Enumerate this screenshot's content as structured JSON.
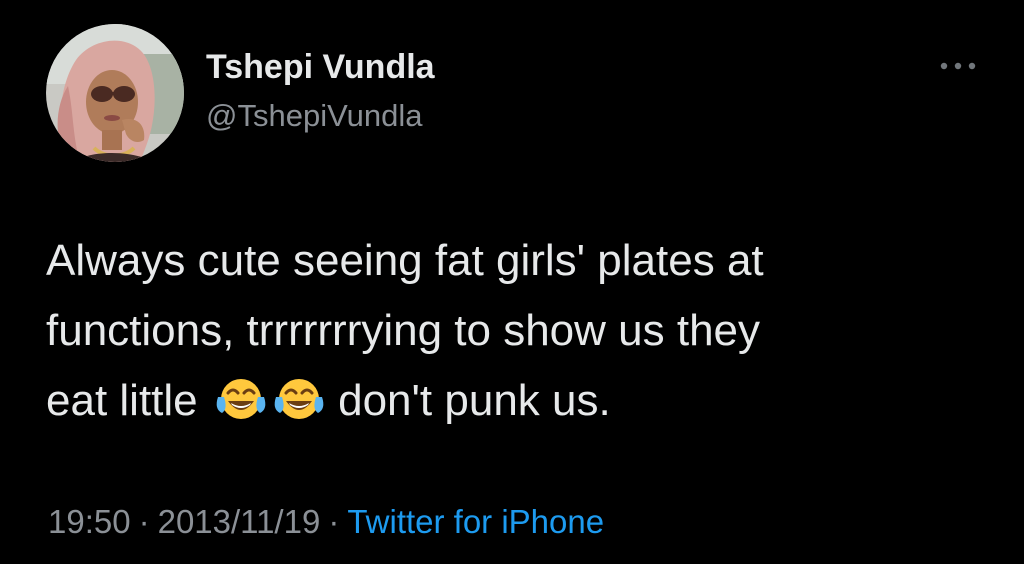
{
  "user": {
    "display_name": "Tshepi Vundla",
    "handle": "@TshepiVundla",
    "avatar_icon": "profile-photo"
  },
  "menu": {
    "icon": "more-horizontal-icon"
  },
  "tweet": {
    "line1": "Always cute seeing fat girls' plates at",
    "line2": "functions, trrrrrrrying to show us they",
    "line3_start": "eat little",
    "emoji": "face-with-tears-of-joy",
    "line3_end": "don't punk us."
  },
  "meta": {
    "time": "19:50",
    "date": "2013/11/19",
    "separator": "·",
    "source": "Twitter for iPhone"
  },
  "colors": {
    "background": "#000000",
    "primary_text": "#e7e9ea",
    "secondary_text": "#8b9096",
    "link": "#1d9bf0"
  }
}
